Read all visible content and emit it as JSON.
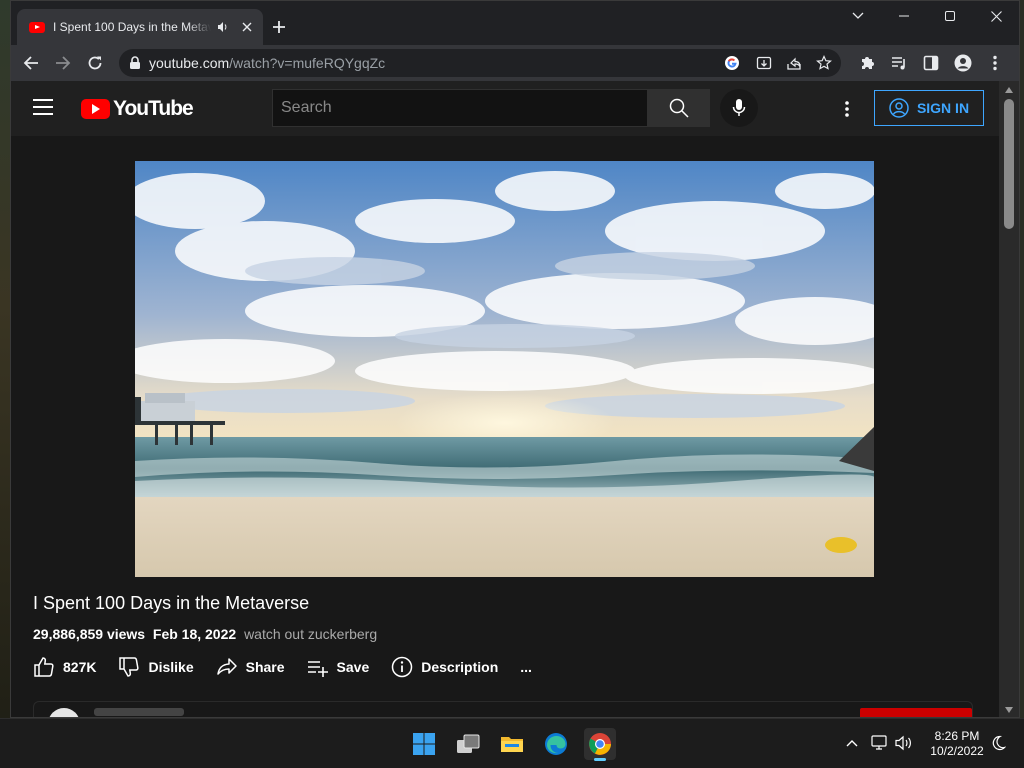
{
  "browser": {
    "tab": {
      "title": "I Spent 100 Days in the Metaverse",
      "audio_icon": "speaker-icon",
      "close_icon": "close-icon"
    },
    "new_tab_icon": "plus-icon",
    "window_controls": [
      "chevron-down-icon",
      "minimize-icon",
      "maximize-icon",
      "close-icon"
    ],
    "url": {
      "domain": "youtube.com",
      "path": "/watch?v=mufeRQYgqZc"
    }
  },
  "youtube": {
    "logo_text": "YouTube",
    "search_placeholder": "Search",
    "sign_in_label": "SIGN IN",
    "video": {
      "title": "I Spent 100 Days in the Metaverse",
      "views": "29,886,859 views",
      "date": "Feb 18, 2022",
      "description": "watch out zuckerberg"
    },
    "actions": {
      "like": "827K",
      "dislike": "Dislike",
      "share": "Share",
      "save": "Save",
      "description": "Description",
      "more": "..."
    }
  },
  "taskbar": {
    "time": "8:26 PM",
    "date": "10/2/2022",
    "apps": [
      "windows-start-icon",
      "task-view-icon",
      "file-explorer-icon",
      "edge-icon",
      "chrome-icon"
    ]
  },
  "colors": {
    "youtube_red": "#ff0000",
    "link_blue": "#3ea6ff",
    "page_bg": "#181818",
    "header_bg": "#202020"
  }
}
